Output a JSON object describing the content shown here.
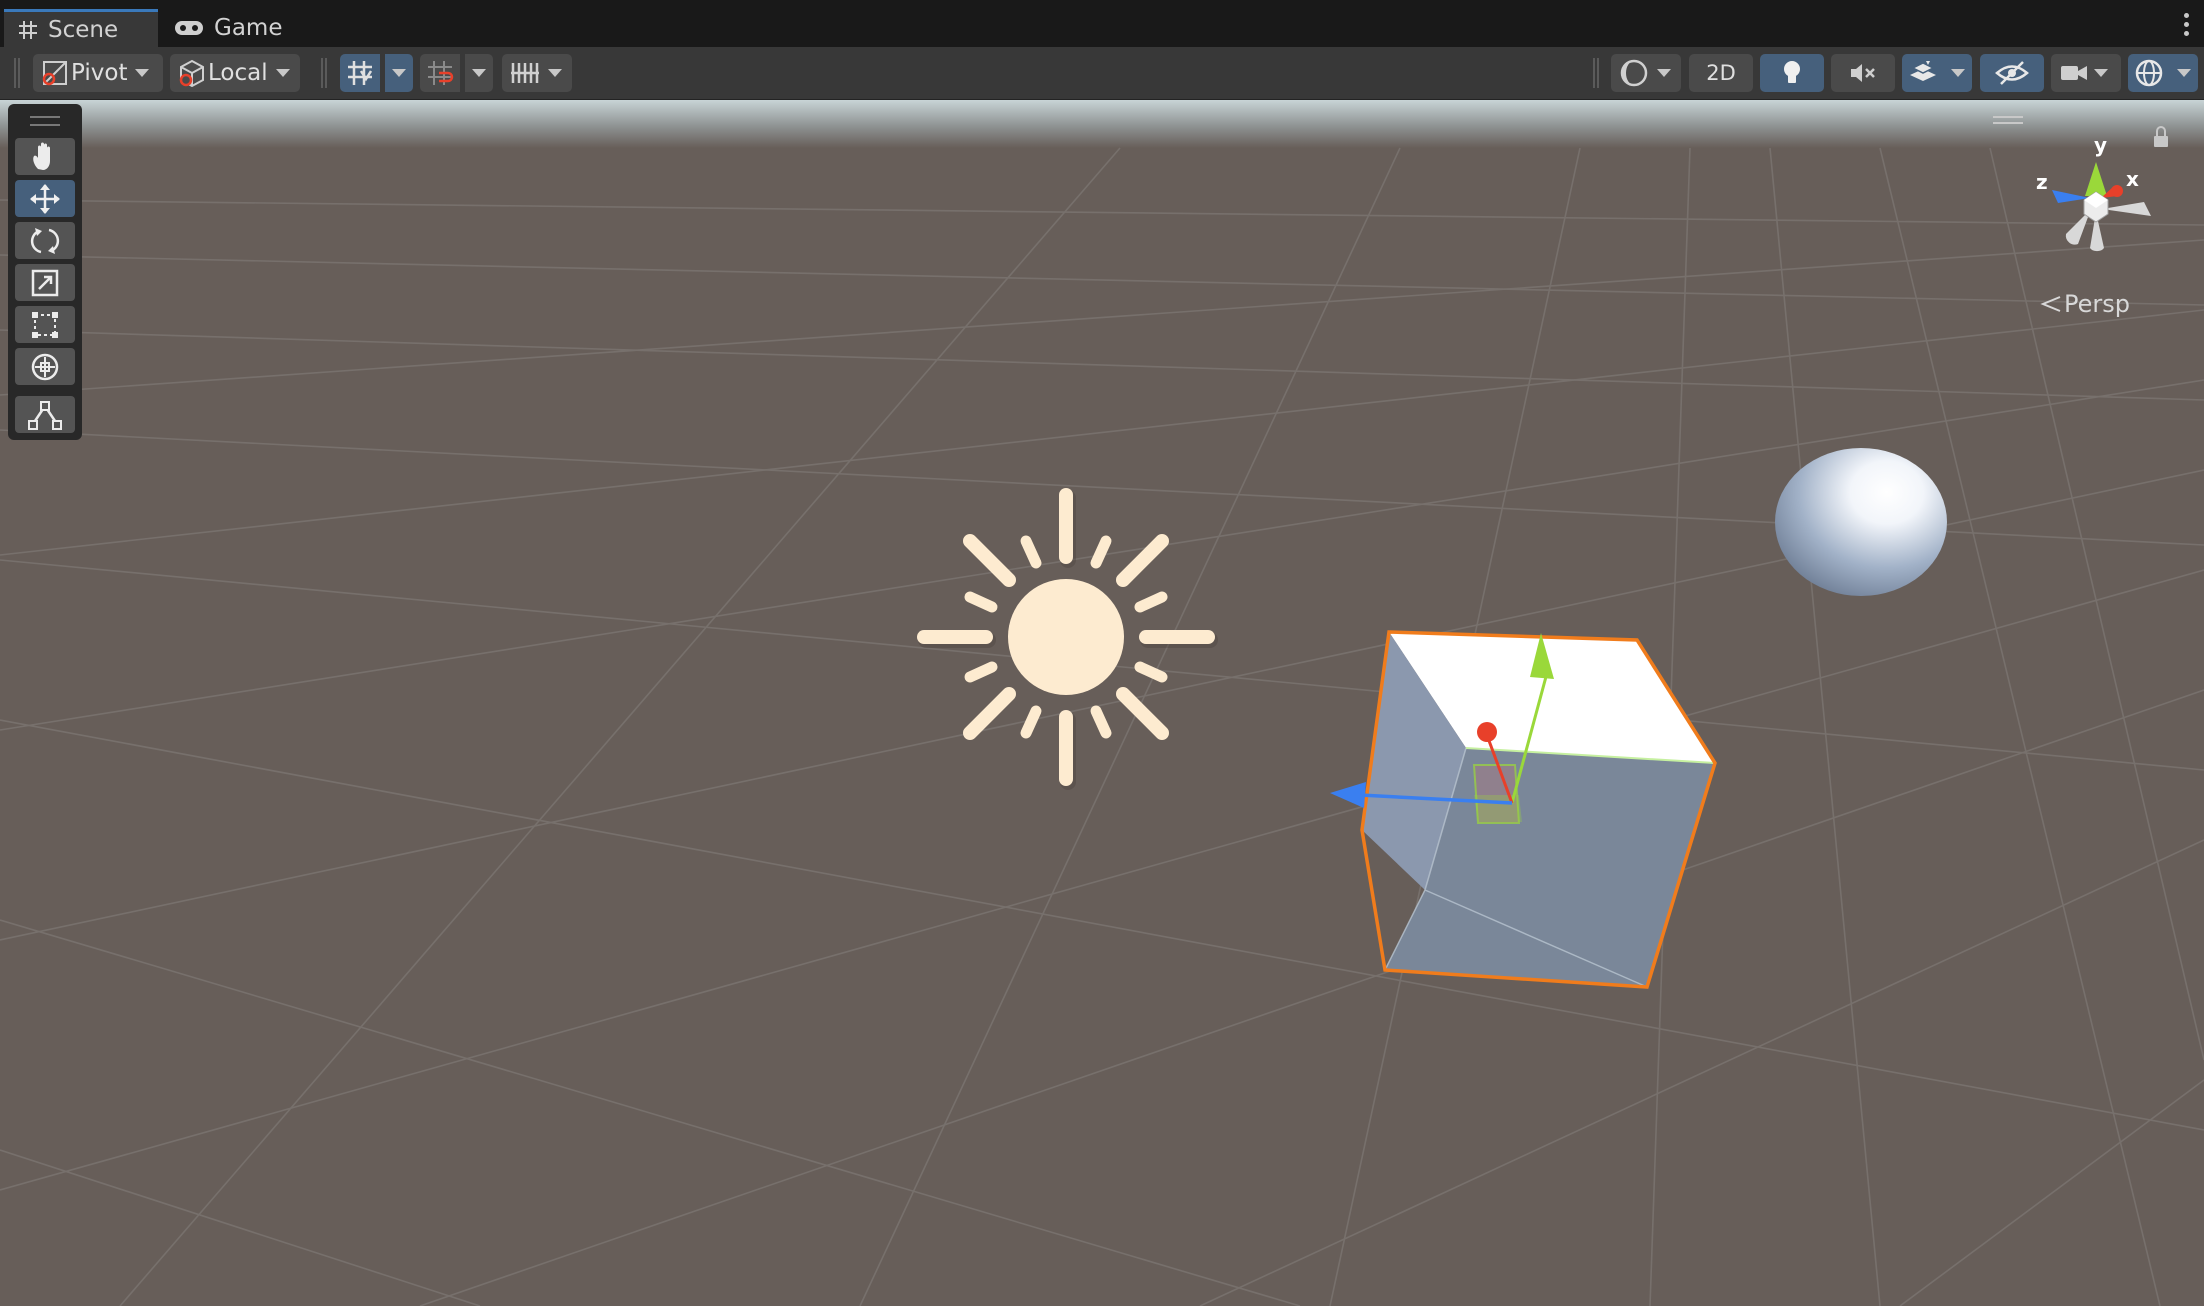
{
  "tabs": [
    {
      "label": "Scene",
      "icon": "hash-grid-icon",
      "active": true
    },
    {
      "label": "Game",
      "icon": "gamepad-icon",
      "active": false
    }
  ],
  "toolbar": {
    "pivot_label": "Pivot",
    "local_label": "Local",
    "two_d_label": "2D"
  },
  "tools": [
    {
      "name": "hand-tool",
      "icon": "hand-icon",
      "active": false
    },
    {
      "name": "move-tool",
      "icon": "move-arrows-icon",
      "active": true
    },
    {
      "name": "rotate-tool",
      "icon": "rotate-icon",
      "active": false
    },
    {
      "name": "scale-tool",
      "icon": "scale-icon",
      "active": false
    },
    {
      "name": "rect-tool",
      "icon": "rect-transform-icon",
      "active": false
    },
    {
      "name": "transform-tool",
      "icon": "transform-icon",
      "active": false
    },
    {
      "name": "custom-tool",
      "icon": "custom-tool-icon",
      "active": false
    }
  ],
  "gizmo": {
    "x_label": "x",
    "y_label": "y",
    "z_label": "z",
    "projection_label": "Persp"
  },
  "colors": {
    "accent": "#3a79bb",
    "active_button": "#46607c",
    "ground": "#675e59",
    "selection_outline": "#f07c1c",
    "axis_x": "#e8402a",
    "axis_y": "#9ad83a",
    "axis_z": "#3a7ff0",
    "sun": "#fdebd0"
  }
}
